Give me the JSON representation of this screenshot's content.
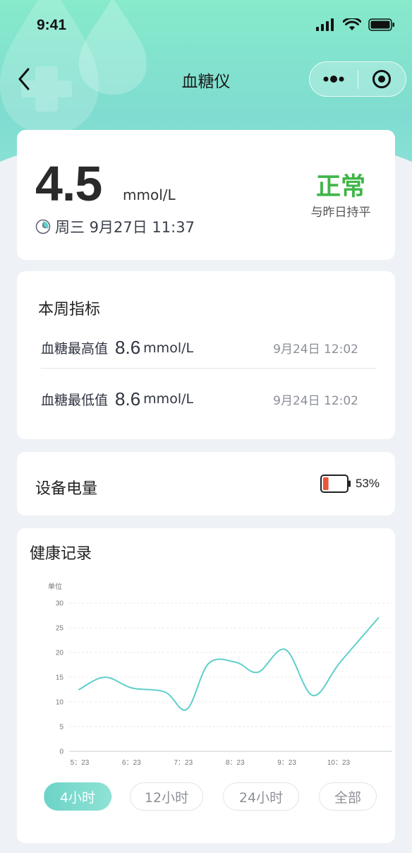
{
  "status_bar": {
    "time": "9:41"
  },
  "nav": {
    "title": "血糖仪"
  },
  "reading": {
    "value": "4.5",
    "unit": "mmol/L",
    "datetime": "周三 9月27日 11:37",
    "status": "正常",
    "comparison": "与昨日持平"
  },
  "weekly": {
    "title": "本周指标",
    "max": {
      "label": "血糖最高值",
      "value": "8.6",
      "unit": "mmol/L",
      "time": "9月24日 12:02"
    },
    "min": {
      "label": "血糖最低值",
      "value": "8.6",
      "unit": "mmol/L",
      "time": "9月24日 12:02"
    }
  },
  "battery": {
    "label": "设备电量",
    "percent_text": "53%",
    "level": 0.53
  },
  "record": {
    "title": "健康记录",
    "ranges": [
      "4小时",
      "12小时",
      "24小时",
      "全部"
    ],
    "active_range": 0
  },
  "colors": {
    "status_normal": "#3fb548",
    "line": "#5fcfca",
    "battery_fill": "#e9553b"
  },
  "chart_data": {
    "type": "line",
    "ylabel": "单位",
    "ylim": [
      0,
      30
    ],
    "yticks": [
      "0",
      "5",
      "10",
      "15",
      "20",
      "25",
      "30"
    ],
    "xticks": [
      "5：23",
      "6：23",
      "7：23",
      "8：23",
      "9：23",
      "10：23"
    ],
    "x": [
      5.23,
      5.7,
      6.2,
      6.8,
      7.2,
      7.6,
      8.1,
      8.5,
      9.0,
      9.5,
      10.0,
      10.7
    ],
    "values": [
      12.5,
      15,
      12.8,
      12,
      8.5,
      17.8,
      18,
      16,
      20.6,
      11.3,
      18,
      27
    ],
    "grid": true,
    "legend": "none"
  }
}
